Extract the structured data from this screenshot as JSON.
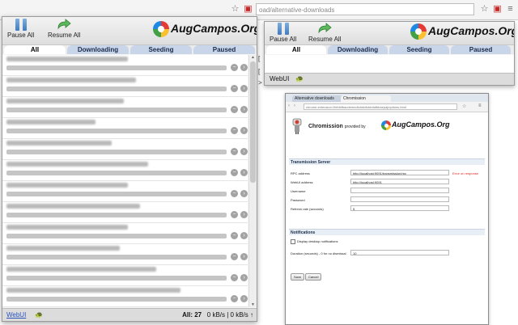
{
  "browser": {
    "url": "oad/alternative-downloads"
  },
  "popup": {
    "toolbar": {
      "pause_all": "Pause All",
      "resume_all": "Resume All"
    },
    "brand": "AugCampos.Org",
    "tabs": [
      "All",
      "Downloading",
      "Seeding",
      "Paused"
    ],
    "rows": 12,
    "footer": {
      "webui": "WebUI",
      "all_count": "All: 27",
      "speed": "0 kB/s | 0 kB/s ↑"
    }
  },
  "popup2": {
    "toolbar": {
      "pause_all": "Pause All",
      "resume_all": "Resume All"
    },
    "brand": "AugCampos.Org",
    "tabs": [
      "All",
      "Downloading",
      "Seeding",
      "Paused"
    ],
    "footer": {
      "webui": "WebUI"
    }
  },
  "options": {
    "tabs": [
      "Alternative downloads",
      "Chromission"
    ],
    "url": "chrome-extension://fdhihfbacdemndlofobdlvklnfafbbaepaj/options.html",
    "title": "Chromission",
    "title_suffix": "provided by",
    "brand": "AugCampos.Org",
    "section_server": "Transmission Server",
    "fields": [
      {
        "label": "RPC address",
        "value": "http://localhost:9091/transmission/rpc"
      },
      {
        "label": "WebUI address",
        "value": "http://localhost:9091"
      },
      {
        "label": "Username",
        "value": ""
      },
      {
        "label": "Password",
        "value": ""
      },
      {
        "label": "Refresh rate (seconds)",
        "value": "5"
      }
    ],
    "error_text": "Error on response",
    "section_notifications": "Notifications",
    "checkbox_label": "Display desktop notifications",
    "duration_label": "Duration (seconds) - 0 for no dismissal",
    "duration_value": "10",
    "save_label": "Save",
    "cancel_label": "Cancel"
  },
  "colors": {
    "tab_active": "#ffffff",
    "tab_inactive": "#c9d6ea",
    "error": "#dd2222"
  }
}
